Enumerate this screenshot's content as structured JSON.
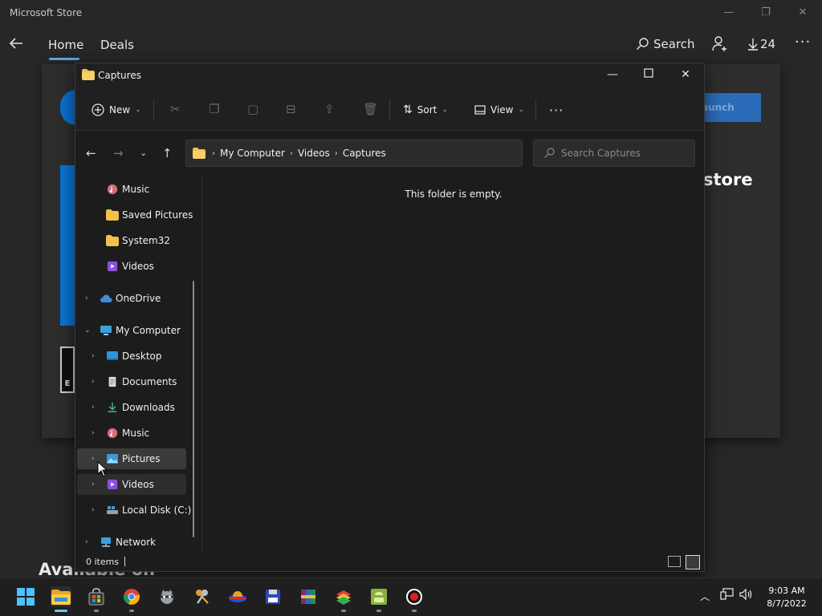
{
  "store": {
    "title": "Microsoft Store",
    "nav": {
      "home": "Home",
      "deals": "Deals",
      "search": "Search",
      "downloads_count": "24"
    },
    "launch_label": "aunch",
    "heading_fragment": "store",
    "available_fragment": "Available on",
    "rating_fragment": "E"
  },
  "explorer": {
    "title": "Captures",
    "toolbar": {
      "new_label": "New",
      "sort_label": "Sort",
      "view_label": "View"
    },
    "breadcrumb": [
      "My Computer",
      "Videos",
      "Captures"
    ],
    "search_placeholder": "Search Captures",
    "empty_message": "This folder is empty.",
    "status_items": "0 items",
    "sidebar": {
      "music_top": "Music",
      "saved_pictures": "Saved Pictures",
      "system32": "System32",
      "videos_top": "Videos",
      "onedrive": "OneDrive",
      "my_computer": "My Computer",
      "desktop": "Desktop",
      "documents": "Documents",
      "downloads": "Downloads",
      "music": "Music",
      "pictures": "Pictures",
      "videos": "Videos",
      "local_disk": "Local Disk (C:)",
      "network": "Network"
    }
  },
  "taskbar": {
    "time": "9:03 AM",
    "date": "8/7/2022",
    "apps": [
      "start",
      "file-explorer",
      "microsoft-store",
      "chrome",
      "raccoon",
      "keys",
      "ufo",
      "save",
      "winrar",
      "bluestacks",
      "android-app",
      "recorder"
    ]
  },
  "colors": {
    "accent": "#60cdff",
    "folder": "#f2c04a",
    "store_blue": "#0a74d4"
  }
}
